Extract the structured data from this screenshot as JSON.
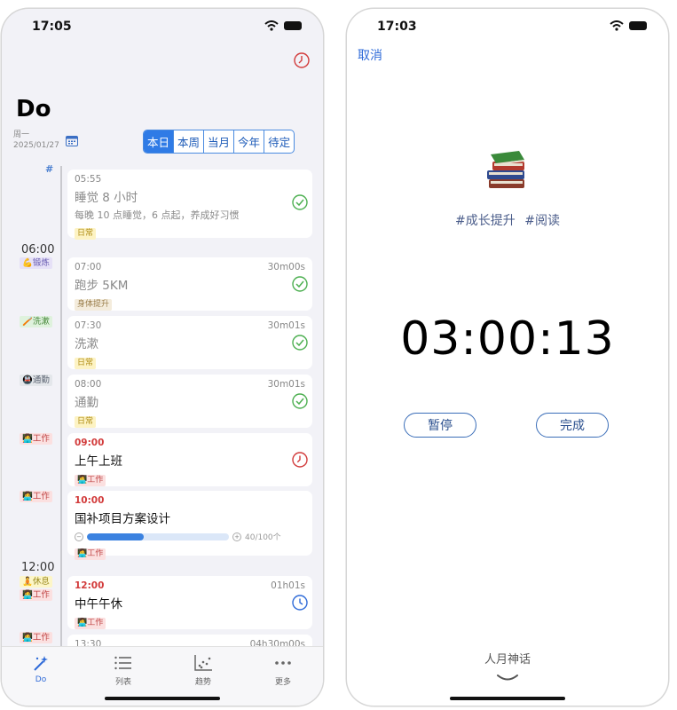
{
  "left": {
    "status_time": "17:05",
    "title": "Do",
    "weekday": "周一",
    "date": "2025/01/27",
    "segments": [
      "本日",
      "本周",
      "当月",
      "今年",
      "待定"
    ],
    "hash": "#",
    "time_labels": [
      "06:00",
      "12:00"
    ],
    "side_tags": {
      "exercise": "💪锻炼",
      "wash": "🪥洗漱",
      "commute": "🚇通勤",
      "work1": "👩‍💻工作",
      "work2": "👩‍💻工作",
      "rest": "🧘休息",
      "work3": "👩‍💻工作",
      "work4": "👩‍💻工作"
    },
    "cards": [
      {
        "time": "05:55",
        "title": "睡觉 8 小时",
        "desc": "每晚 10 点睡觉，6 点起，养成好习惯",
        "tag": "日常"
      },
      {
        "time": "07:00",
        "duration": "30m00s",
        "title": "跑步 5KM",
        "tag": "身体提升"
      },
      {
        "time": "07:30",
        "duration": "30m01s",
        "title": "洗漱",
        "tag": "日常"
      },
      {
        "time": "08:00",
        "duration": "30m01s",
        "title": "通勤",
        "tag": "日常"
      },
      {
        "time": "09:00",
        "title": "上午上班",
        "tag": "👩‍💻工作"
      },
      {
        "time": "10:00",
        "title": "国补项目方案设计",
        "progress": 0.4,
        "progress_text": "40/100个",
        "tag": "👩‍💻工作"
      },
      {
        "time": "12:00",
        "duration": "01h01s",
        "title": "中午午休",
        "tag": "👩‍💻工作"
      },
      {
        "time": "13:30",
        "duration": "04h30m00s"
      }
    ],
    "tabs": [
      "Do",
      "列表",
      "趋势",
      "更多"
    ],
    "colors": {
      "accent": "#2f7be6",
      "done": "#4caf50",
      "alert": "#d23b3b"
    }
  },
  "right": {
    "status_time": "17:03",
    "cancel": "取消",
    "hashtags": [
      "#成长提升",
      "#阅读"
    ],
    "timer": "03:00:13",
    "pause": "暂停",
    "finish": "完成",
    "book_title": "人月神话"
  }
}
